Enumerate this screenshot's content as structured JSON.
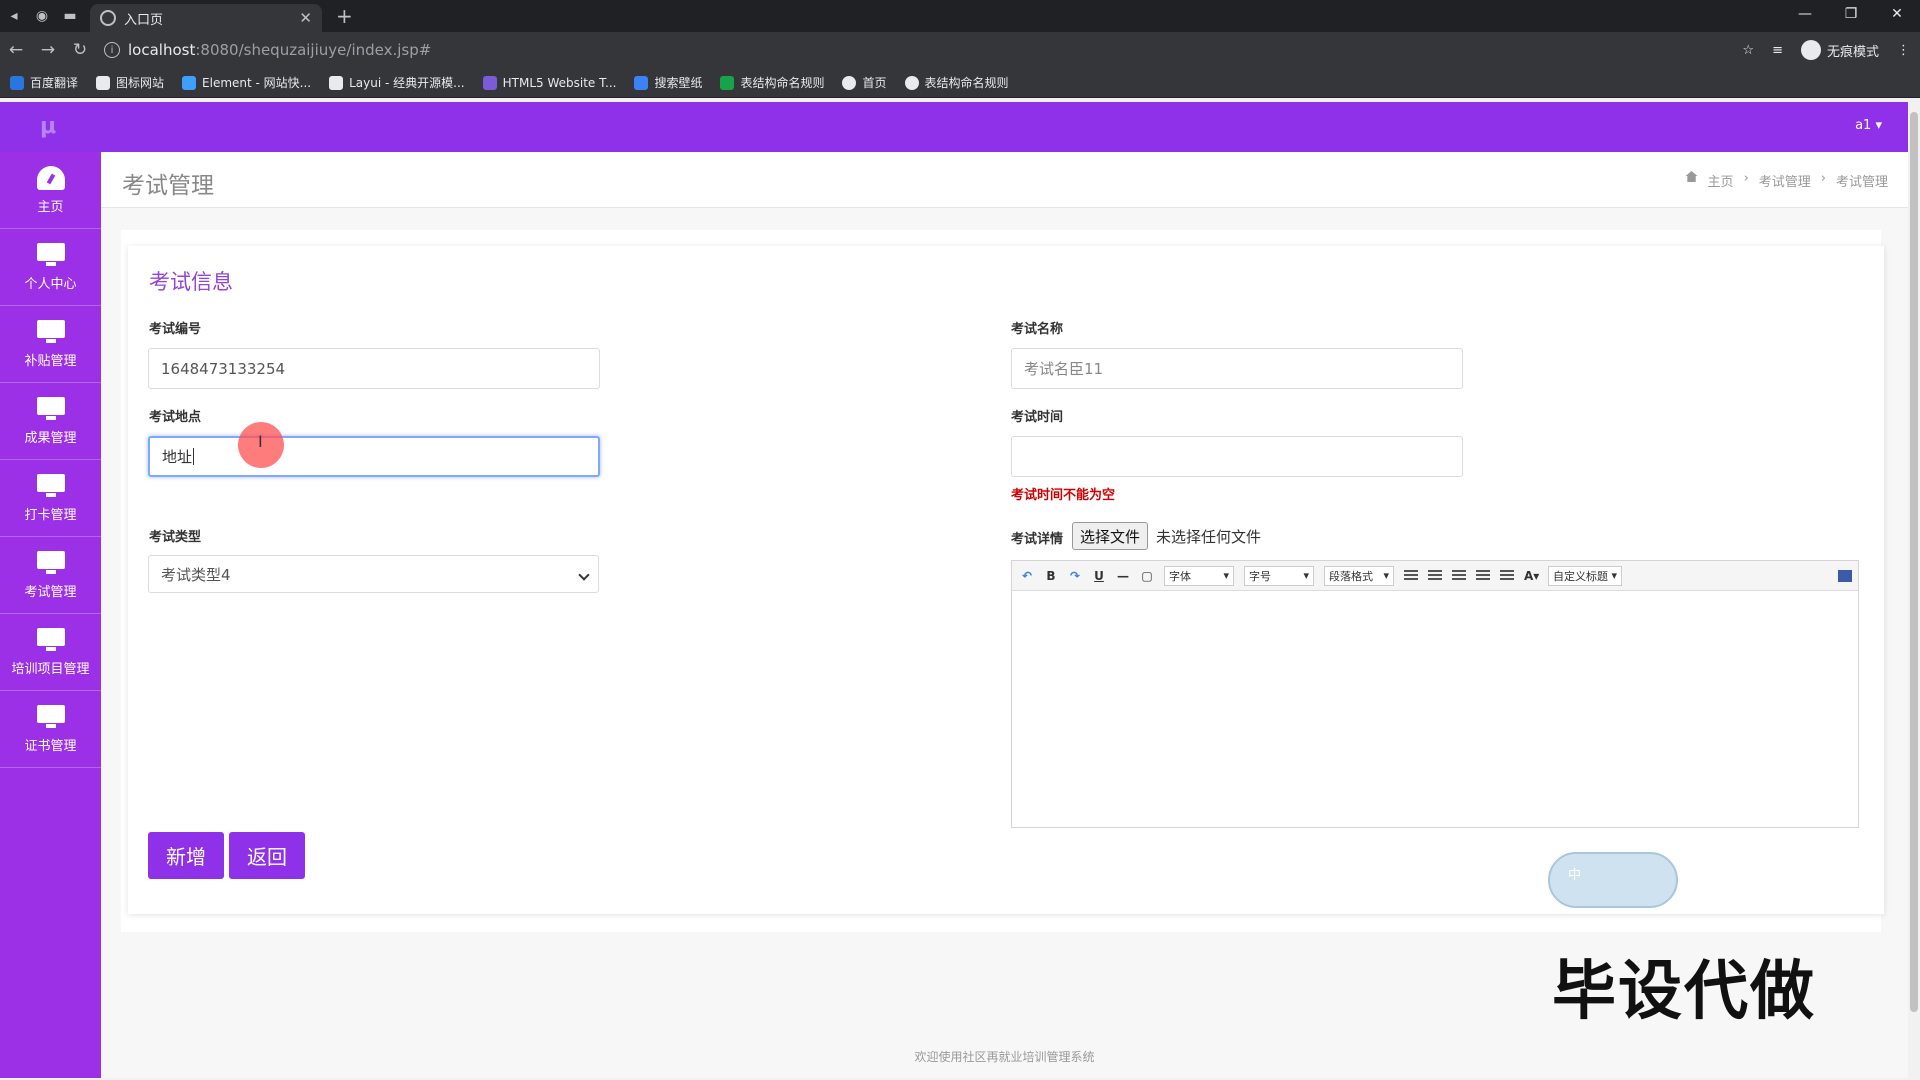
{
  "browser": {
    "tab_title": "入口页",
    "url_host": "localhost",
    "url_path": ":8080/shequzaijiuye/index.jsp#",
    "incognito_label": "无痕模式",
    "bookmarks": [
      {
        "label": "百度翻译",
        "color": "#2a76e0"
      },
      {
        "label": "图标网站",
        "color": "#e8eaed"
      },
      {
        "label": "Element - 网站快...",
        "color": "#409eff"
      },
      {
        "label": "Layui - 经典开源模...",
        "color": "#e8eaed"
      },
      {
        "label": "HTML5 Website T...",
        "color": "#7a5cd6"
      },
      {
        "label": "搜索壁纸",
        "color": "#3b82f6"
      },
      {
        "label": "表结构命名规则",
        "color": "#16a34a"
      },
      {
        "label": "首页",
        "color": "#e8eaed"
      },
      {
        "label": "表结构命名规则",
        "color": "#e8eaed"
      }
    ]
  },
  "app": {
    "logo": "μ",
    "user": "a1 ▾",
    "accent": "#8e31e8",
    "sidebar": [
      {
        "label": "主页",
        "icon": "dashboard-icon"
      },
      {
        "label": "个人中心",
        "icon": "monitor-icon"
      },
      {
        "label": "补贴管理",
        "icon": "monitor-icon"
      },
      {
        "label": "成果管理",
        "icon": "monitor-icon"
      },
      {
        "label": "打卡管理",
        "icon": "monitor-icon"
      },
      {
        "label": "考试管理",
        "icon": "monitor-icon"
      },
      {
        "label": "培训项目管理",
        "icon": "monitor-icon"
      },
      {
        "label": "证书管理",
        "icon": "monitor-icon"
      }
    ],
    "page_title": "考试管理",
    "breadcrumb": [
      "主页",
      "考试管理",
      "考试管理"
    ],
    "form": {
      "title": "考试信息",
      "exam_no_label": "考试编号",
      "exam_no_value": "1648473133254",
      "exam_name_label": "考试名称",
      "exam_name_placeholder": "考试名臣11",
      "exam_place_label": "考试地点",
      "exam_place_value": "地址",
      "exam_time_label": "考试时间",
      "exam_time_value": "",
      "exam_time_error": "考试时间不能为空",
      "exam_type_label": "考试类型",
      "exam_type_value": "考试类型4",
      "exam_detail_label": "考试详情",
      "file_button": "选择文件",
      "file_none": "未选择任何文件",
      "editor_toolbar": {
        "font": "字体",
        "size": "字号",
        "paragraph": "段落格式",
        "custom_title": "自定义标题"
      },
      "add_button": "新增",
      "back_button": "返回"
    },
    "footer": "欢迎使用社区再就业培训管理系统",
    "watermark": "毕设代做",
    "ime_label": "中"
  }
}
